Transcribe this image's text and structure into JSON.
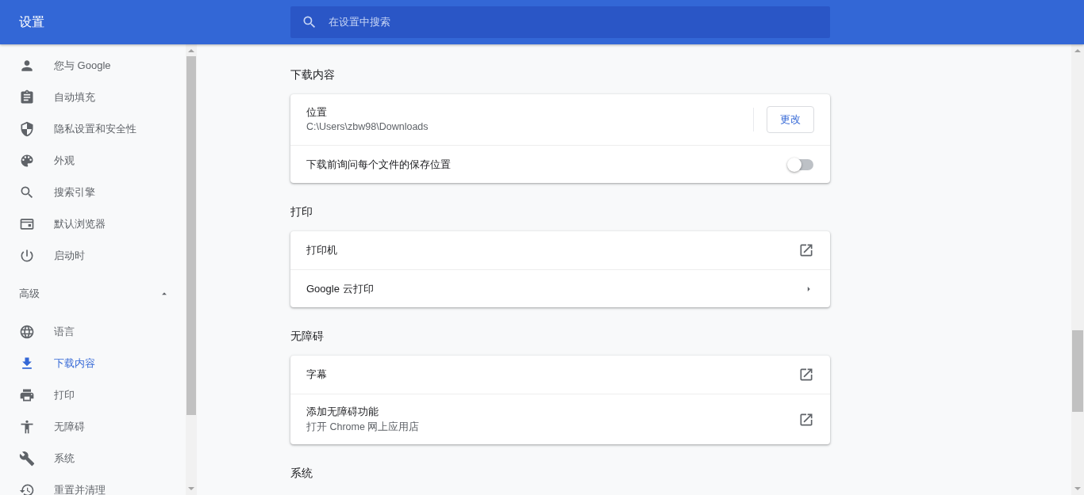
{
  "header": {
    "title": "设置",
    "search": {
      "placeholder": "在设置中搜索"
    }
  },
  "sidebar": {
    "items": [
      {
        "label": "您与 Google",
        "kind": "person",
        "selected": false
      },
      {
        "label": "自动填充",
        "kind": "clipboard",
        "selected": false
      },
      {
        "label": "隐私设置和安全性",
        "kind": "shield",
        "selected": false
      },
      {
        "label": "外观",
        "kind": "palette",
        "selected": false
      },
      {
        "label": "搜索引擎",
        "kind": "search",
        "selected": false
      },
      {
        "label": "默认浏览器",
        "kind": "browser",
        "selected": false
      },
      {
        "label": "启动时",
        "kind": "power",
        "selected": false
      }
    ],
    "advanced": {
      "label": "高级",
      "expanded": true,
      "items": [
        {
          "label": "语言",
          "kind": "globe",
          "selected": false
        },
        {
          "label": "下载内容",
          "kind": "download",
          "selected": true
        },
        {
          "label": "打印",
          "kind": "printer",
          "selected": false
        },
        {
          "label": "无障碍",
          "kind": "accessibility",
          "selected": false
        },
        {
          "label": "系统",
          "kind": "wrench",
          "selected": false
        },
        {
          "label": "重置并清理",
          "kind": "history",
          "selected": false
        }
      ]
    }
  },
  "sections": [
    {
      "title": "下载内容",
      "rows": [
        {
          "kind": "button",
          "label": "位置",
          "secondary": "C:\\Users\\zbw98\\Downloads",
          "button": "更改"
        },
        {
          "kind": "toggle",
          "label": "下载前询问每个文件的保存位置",
          "on": false
        }
      ]
    },
    {
      "title": "打印",
      "rows": [
        {
          "kind": "external",
          "label": "打印机"
        },
        {
          "kind": "arrow",
          "label": "Google 云打印"
        }
      ]
    },
    {
      "title": "无障碍",
      "rows": [
        {
          "kind": "external",
          "label": "字幕"
        },
        {
          "kind": "external",
          "label": "添加无障碍功能",
          "secondary": "打开 Chrome 网上应用店"
        }
      ]
    },
    {
      "title": "系统"
    }
  ]
}
